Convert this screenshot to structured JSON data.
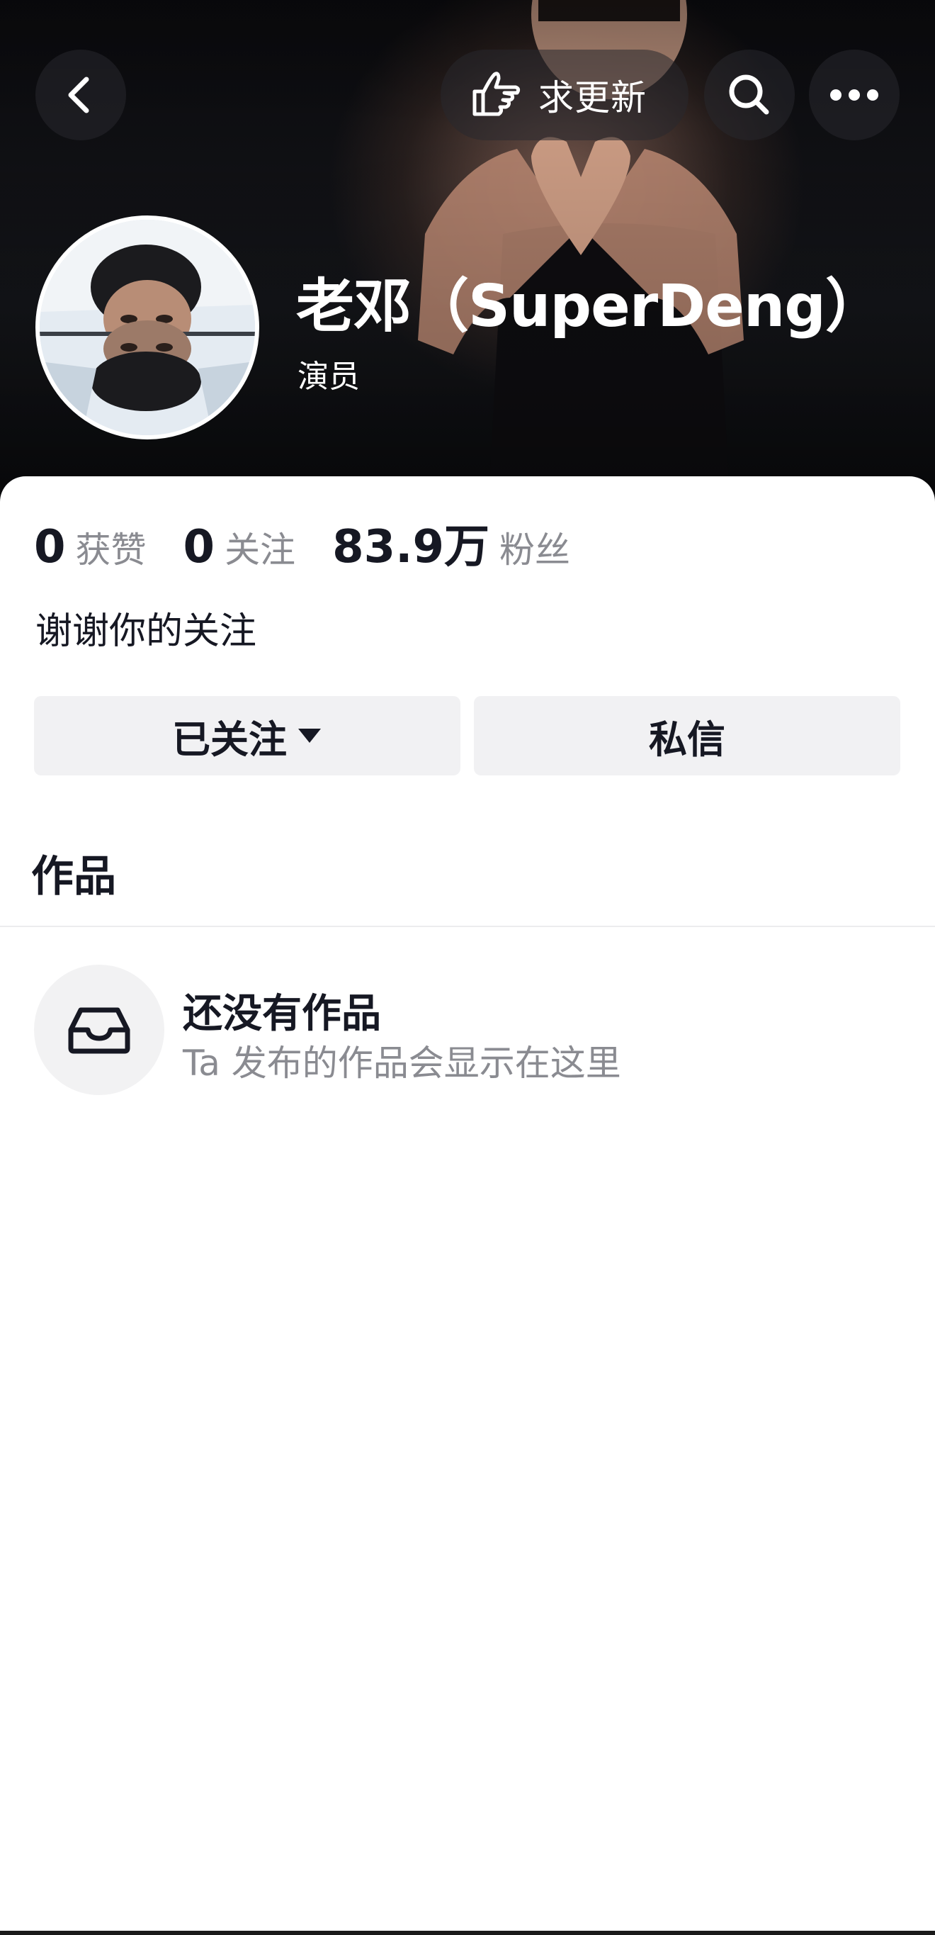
{
  "header": {
    "update_label": "求更新"
  },
  "profile": {
    "name": "老邓（SuperDeng）",
    "tagline": "演员",
    "bio": "谢谢你的关注"
  },
  "stats": [
    {
      "value": "0",
      "label": "获赞"
    },
    {
      "value": "0",
      "label": "关注"
    },
    {
      "value": "83.9万",
      "label": "粉丝"
    }
  ],
  "actions": {
    "follow_label": "已关注",
    "message_label": "私信"
  },
  "works": {
    "title": "作品",
    "empty_title": "还没有作品",
    "empty_subtitle": "Ta 发布的作品会显示在这里"
  },
  "icons": {
    "back": "chevron-left-icon",
    "update": "pointing-hand-icon",
    "search": "search-icon",
    "more": "more-dots-icon",
    "empty": "inbox-tray-icon"
  },
  "colors": {
    "text_primary": "#161823",
    "text_secondary": "#8a8b91",
    "button_bg": "#f1f1f3"
  }
}
